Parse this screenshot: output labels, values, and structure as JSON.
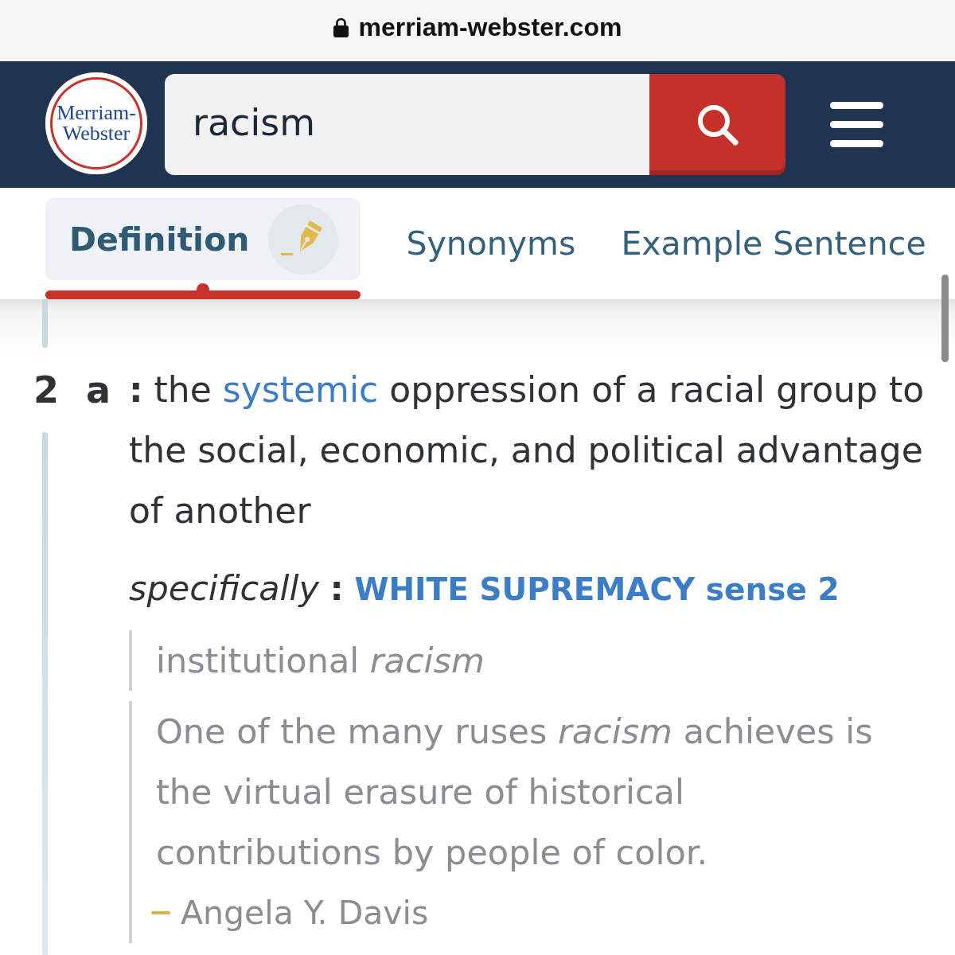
{
  "browser_bar": {
    "url": "merriam-webster.com",
    "secure": true
  },
  "header": {
    "logo_lines": [
      "Merriam-",
      "Webster"
    ],
    "search": {
      "value": "racism"
    }
  },
  "tabs": [
    {
      "label": "Definition",
      "selected": true,
      "icon": true
    },
    {
      "label": "Synonyms",
      "selected": false,
      "icon": false
    },
    {
      "label": "Example Sentence",
      "selected": false,
      "icon": false
    }
  ],
  "sense": {
    "number": "2",
    "letter": "a",
    "separator": ":",
    "definition": [
      {
        "kind": "text",
        "text": "the "
      },
      {
        "kind": "link",
        "text": "systemic"
      },
      {
        "kind": "text",
        "text": " oppression of a racial group to the social, economic, and political advantage of another"
      }
    ],
    "specifically": {
      "label": "specifically",
      "separator": ":",
      "link": "WHITE SUPREMACY sense 2"
    },
    "examples": [
      {
        "text": "institutional *racism*"
      },
      {
        "text": "One of the many ruses *racism* achieves is the virtual erasure of historical contributions by people of color.",
        "attribution": "Angela Y. Davis"
      }
    ]
  }
}
